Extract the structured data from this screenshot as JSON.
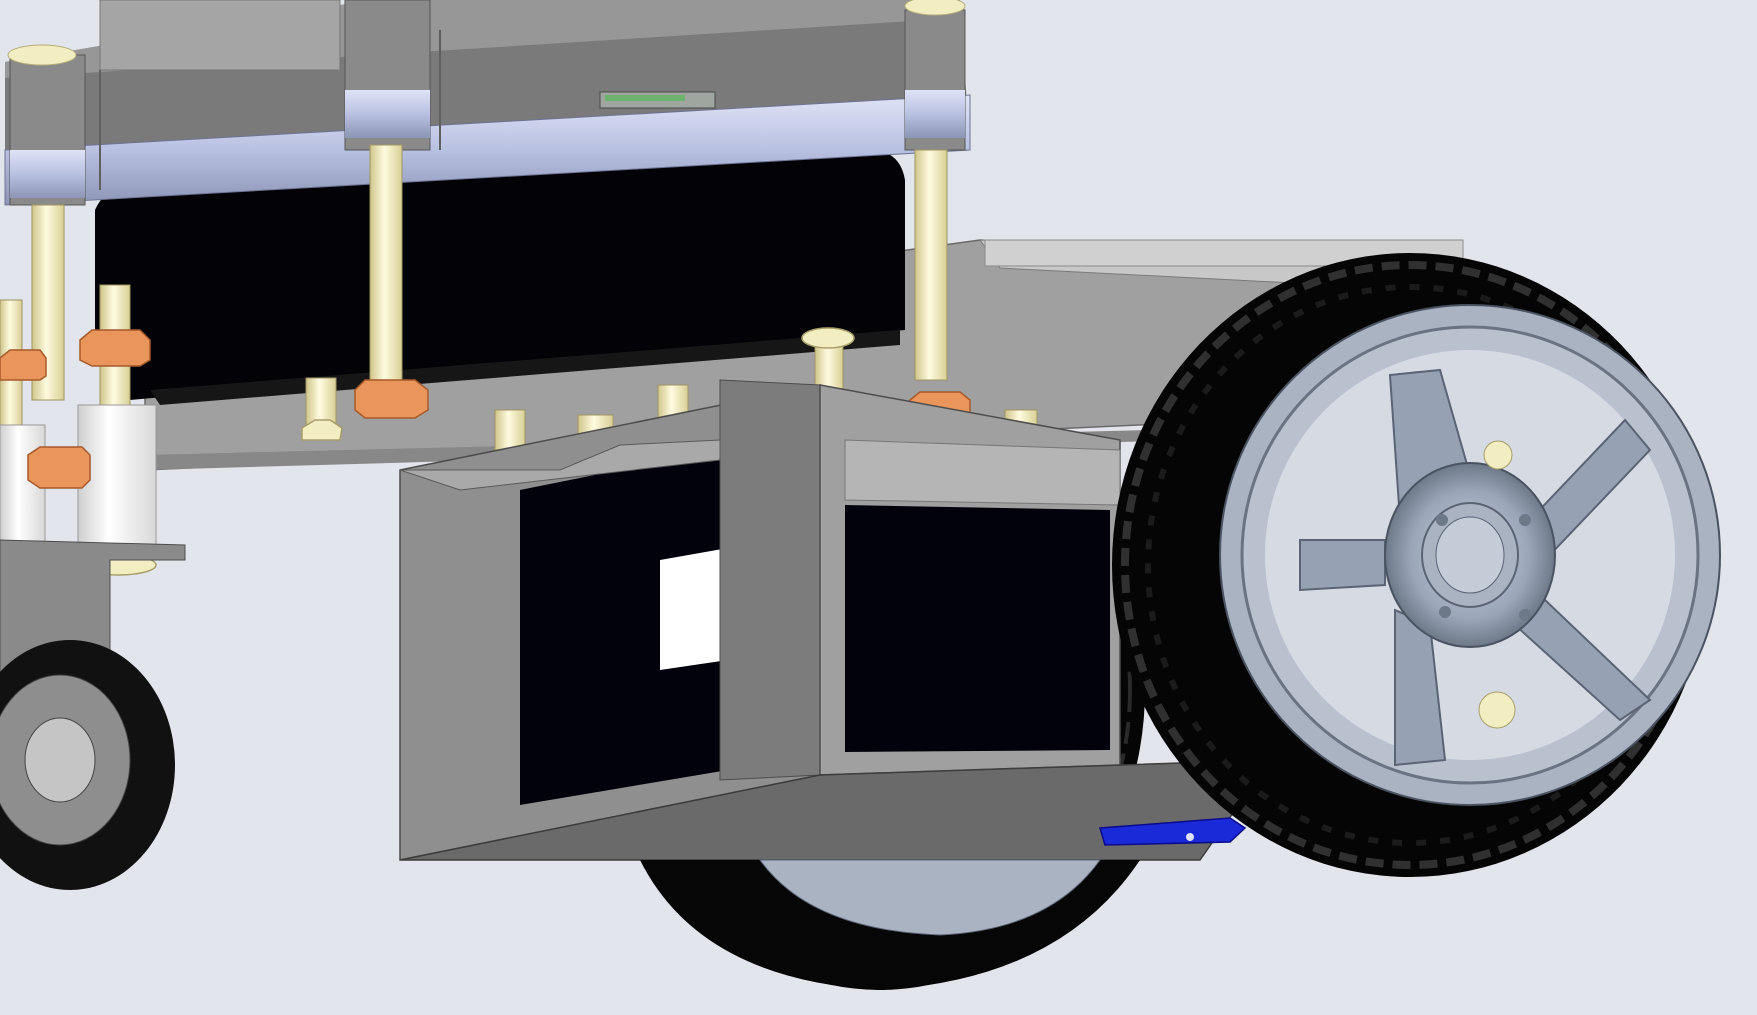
{
  "scene": {
    "subject": "robot-chassis-cad-render",
    "colors": {
      "background": "#e3e5ec",
      "chassis_gray": "#8c8c8c",
      "chassis_dark": "#6f6f6f",
      "plate_gray": "#9a9a9a",
      "accent_band": "#bfc6e6",
      "standoff_yellow": "#f5efb8",
      "nut_orange": "#e9955c",
      "tire_black": "#060606",
      "hub_blue_gray": "#9aa6b8",
      "battery_black": "#02020c",
      "sensor_blue": "#1a2ad8",
      "caster_gray": "#8a8a8a"
    },
    "icons": [
      "wheel-icon",
      "tire-icon",
      "caster-icon",
      "standoff-icon",
      "nut-icon",
      "screw-icon"
    ]
  }
}
